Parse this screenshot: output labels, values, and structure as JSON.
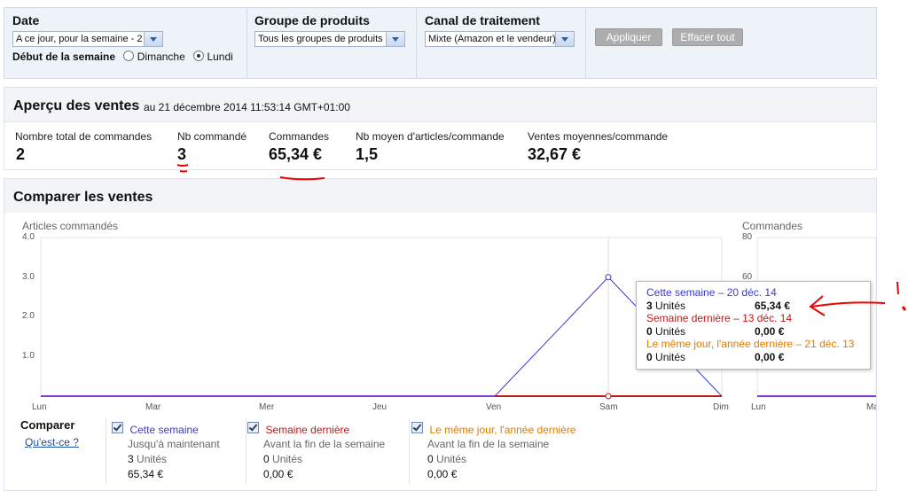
{
  "filters": {
    "date": {
      "label": "Date",
      "select_value": "A ce jour, pour la semaine - 2",
      "week_start_label": "Début de la semaine",
      "options": [
        "Dimanche",
        "Lundi"
      ],
      "selected": "Lundi"
    },
    "product_group": {
      "label": "Groupe de produits",
      "select_value": "Tous les groupes de produits"
    },
    "channel": {
      "label": "Canal de traitement",
      "select_value": "Mixte (Amazon et le vendeur)"
    },
    "apply_label": "Appliquer",
    "clear_label": "Effacer tout"
  },
  "summary": {
    "title": "Aperçu des ventes",
    "timestamp": "au 21 décembre 2014 11:53:14 GMT+01:00",
    "metrics": [
      {
        "label": "Nombre total de commandes",
        "value": "2"
      },
      {
        "label": "Nb commandé",
        "value": "3"
      },
      {
        "label": "Commandes",
        "value": "65,34 €"
      },
      {
        "label": "Nb moyen d'articles/commande",
        "value": "1,5"
      },
      {
        "label": "Ventes moyennes/commande",
        "value": "32,67 €"
      }
    ]
  },
  "compare": {
    "title": "Comparer les ventes",
    "left_chart": {
      "ylabel": "Articles commandés",
      "yticks": [
        "4.0",
        "3.0",
        "2.0",
        "1.0"
      ]
    },
    "right_chart": {
      "ylabel": "Commandes",
      "yticks": [
        "80",
        "60"
      ],
      "xticks": [
        "Lun",
        "Ma"
      ]
    },
    "days": [
      "Lun",
      "Mar",
      "Mer",
      "Jeu",
      "Ven",
      "Sam",
      "Dim"
    ],
    "legend_title": "Comparer",
    "legend_link": "Qu'est-ce ?",
    "series": [
      {
        "name": "Cette semaine",
        "subtitle": "Jusqu'à maintenant",
        "units": "3",
        "units_label": "Unités",
        "amount": "65,34 €",
        "color": "#3b3bd1"
      },
      {
        "name": "Semaine dernière",
        "subtitle": "Avant la fin de la semaine",
        "units": "0",
        "units_label": "Unités",
        "amount": "0,00 €",
        "color": "#c01818"
      },
      {
        "name": "Le même jour, l'année dernière",
        "subtitle": "Avant la fin de la semaine",
        "units": "0",
        "units_label": "Unités",
        "amount": "0,00 €",
        "color": "#e07b00"
      }
    ],
    "tooltip": {
      "rows": [
        {
          "title": "Cette semaine – 20 déc. 14",
          "units": "3",
          "units_label": "Unités",
          "amount": "65,34 €"
        },
        {
          "title": "Semaine dernière – 13 déc. 14",
          "units": "0",
          "units_label": "Unités",
          "amount": "0,00 €"
        },
        {
          "title": "Le même jour, l'année dernière – 21 déc. 13",
          "units": "0",
          "units_label": "Unités",
          "amount": "0,00 €"
        }
      ]
    }
  },
  "chart_data": {
    "type": "line",
    "categories": [
      "Lun",
      "Mar",
      "Mer",
      "Jeu",
      "Ven",
      "Sam",
      "Dim"
    ],
    "series": [
      {
        "name": "Cette semaine",
        "values": [
          0,
          0,
          0,
          0,
          0,
          3,
          0
        ]
      },
      {
        "name": "Semaine dernière",
        "values": [
          0,
          0,
          0,
          0,
          0,
          0,
          0
        ]
      }
    ],
    "ylabel": "Articles commandés",
    "ylim": [
      0,
      4
    ]
  }
}
